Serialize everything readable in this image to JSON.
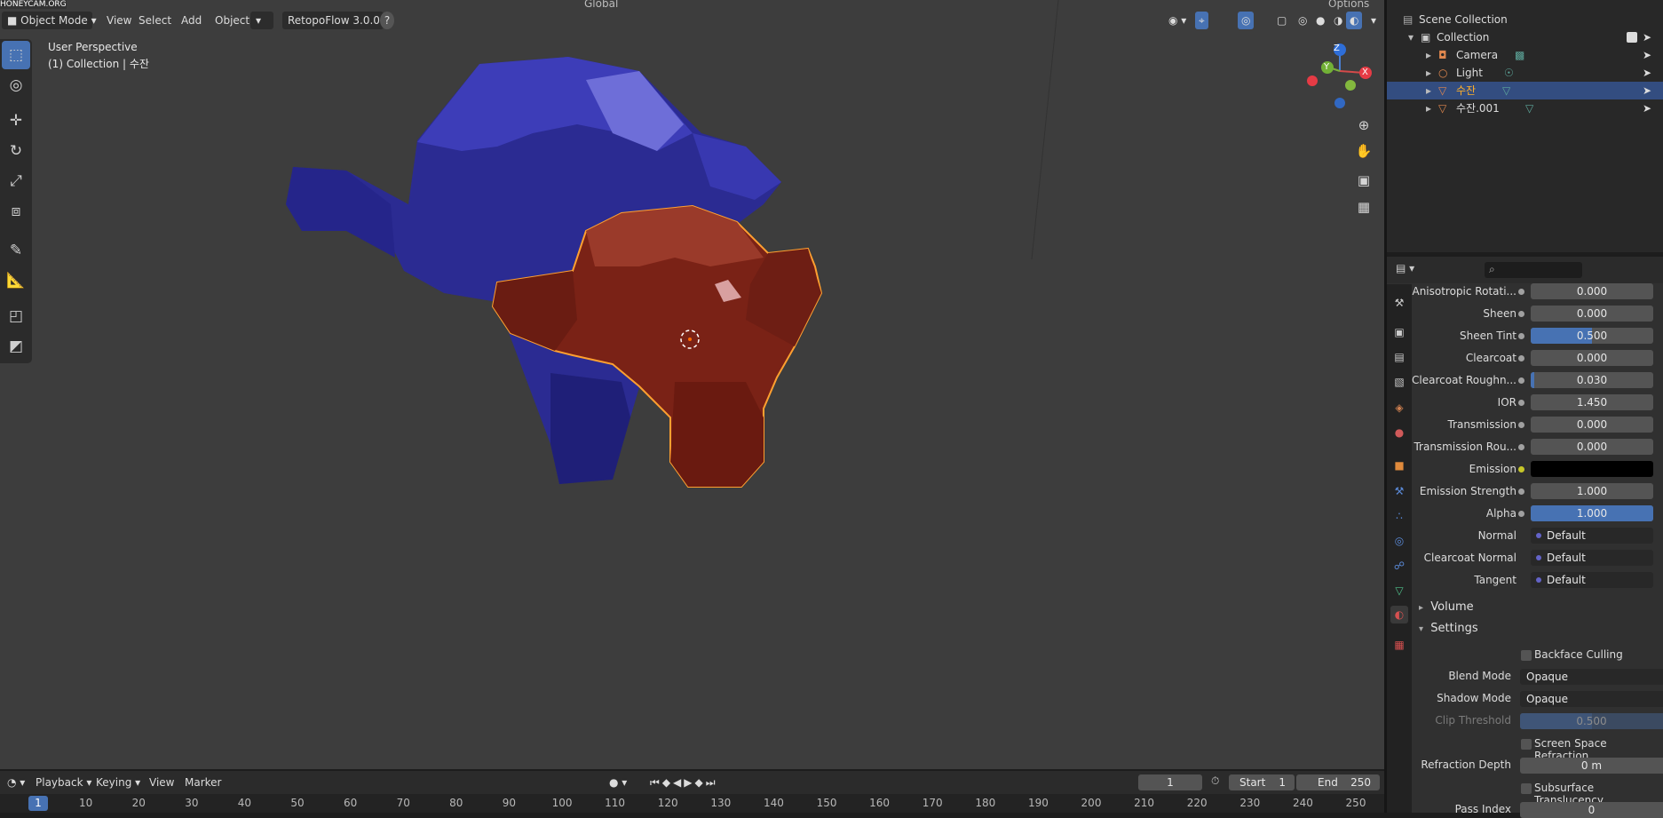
{
  "watermark": "HONEYCAM.ORG",
  "header": {
    "mode": "Object Mode",
    "menu": [
      "View",
      "Select",
      "Add",
      "Object"
    ],
    "addon": "RetopoFlow 3.0.0",
    "help": "?",
    "transform_orientation": "Global",
    "options": "Options"
  },
  "viewport": {
    "perspective": "User Perspective",
    "collection_info": "(1) Collection | 수잔",
    "gizmo": {
      "z": "Z",
      "y": "Y",
      "x": "X"
    }
  },
  "toolbar": [
    "select-box",
    "cursor",
    "move",
    "rotate",
    "scale",
    "transform",
    "annotate",
    "measure",
    "add-cube",
    "extrude"
  ],
  "outliner": {
    "root": "Scene Collection",
    "collection": "Collection",
    "items": [
      {
        "name": "Camera",
        "selected": false
      },
      {
        "name": "Light",
        "selected": false
      },
      {
        "name": "수잔",
        "selected": true
      },
      {
        "name": "수잔.001",
        "selected": false
      }
    ]
  },
  "properties": {
    "search_placeholder": "",
    "rows": [
      {
        "label": "Anisotropic Rotati...",
        "value": "0.000",
        "fill": 0
      },
      {
        "label": "Sheen",
        "value": "0.000",
        "fill": 0
      },
      {
        "label": "Sheen Tint",
        "value": "0.500",
        "fill": 0.5
      },
      {
        "label": "Clearcoat",
        "value": "0.000",
        "fill": 0
      },
      {
        "label": "Clearcoat Roughn...",
        "value": "0.030",
        "fill": 0.03
      },
      {
        "label": "IOR",
        "value": "1.450",
        "fill": 0
      },
      {
        "label": "Transmission",
        "value": "0.000",
        "fill": 0
      },
      {
        "label": "Transmission Rou...",
        "value": "0.000",
        "fill": 0
      },
      {
        "label": "Emission",
        "value": "",
        "color": "#000000"
      },
      {
        "label": "Emission Strength",
        "value": "1.000",
        "fill": 0
      },
      {
        "label": "Alpha",
        "value": "1.000",
        "fill": 1
      }
    ],
    "links": [
      {
        "label": "Normal",
        "value": "Default"
      },
      {
        "label": "Clearcoat Normal",
        "value": "Default"
      },
      {
        "label": "Tangent",
        "value": "Default"
      }
    ],
    "volume": "Volume",
    "settings": "Settings",
    "backface": "Backface Culling",
    "blend_label": "Blend Mode",
    "blend_value": "Opaque",
    "shadow_label": "Shadow Mode",
    "shadow_value": "Opaque",
    "clip_label": "Clip Threshold",
    "clip_value": "0.500",
    "ssr": "Screen Space Refraction",
    "refraction_label": "Refraction Depth",
    "refraction_value": "0 m",
    "subsurface": "Subsurface Translucency",
    "pass_label": "Pass Index",
    "pass_value": "0"
  },
  "timeline": {
    "menu": [
      "Playback",
      "Keying",
      "View",
      "Marker"
    ],
    "current_frame": "1",
    "start_label": "Start",
    "start": "1",
    "end_label": "End",
    "end": "250",
    "ruler": [
      "1",
      "10",
      "20",
      "30",
      "40",
      "50",
      "60",
      "70",
      "80",
      "90",
      "100",
      "110",
      "120",
      "130",
      "140",
      "150",
      "160",
      "170",
      "180",
      "190",
      "200",
      "210",
      "220",
      "230",
      "240",
      "250"
    ]
  },
  "colors": {
    "accent": "#4772b3",
    "selected_outline": "#ffa030",
    "blue_mesh": "#3030a8",
    "red_mesh": "#8a2418"
  }
}
